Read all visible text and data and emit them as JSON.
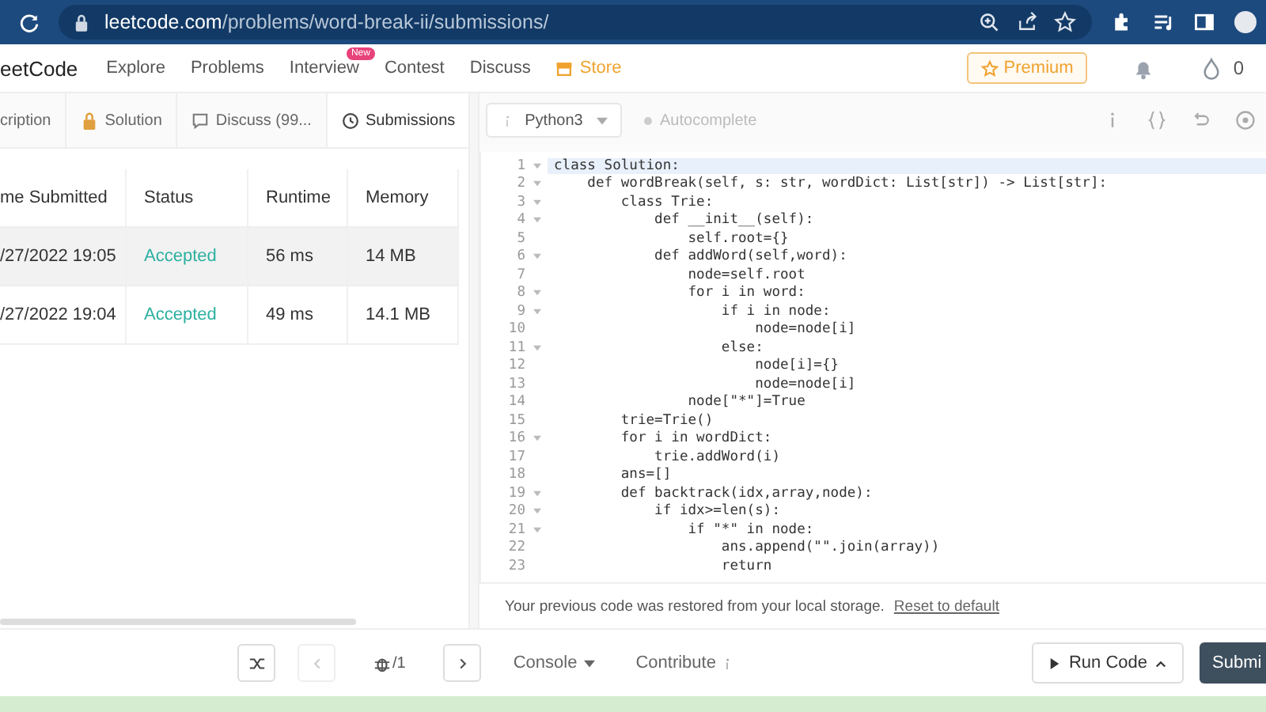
{
  "browser": {
    "url_host": "leetcode.com",
    "url_path": "/problems/word-break-ii/submissions/"
  },
  "nav": {
    "logo": "eetCode",
    "links": [
      {
        "label": "Explore",
        "kind": "plain"
      },
      {
        "label": "Problems",
        "kind": "plain"
      },
      {
        "label": "Interview",
        "badge": "New",
        "kind": "plain"
      },
      {
        "label": "Contest",
        "kind": "plain"
      },
      {
        "label": "Discuss",
        "kind": "plain"
      },
      {
        "label": "Store",
        "kind": "store"
      }
    ],
    "premium": "Premium",
    "coins": "0"
  },
  "tabs": [
    {
      "label": "cription",
      "selected": false
    },
    {
      "label": "Solution",
      "selected": false
    },
    {
      "label": "Discuss (99...",
      "selected": false
    },
    {
      "label": "Submissions",
      "selected": true
    }
  ],
  "table": {
    "columns": [
      "me Submitted",
      "Status",
      "Runtime",
      "Memory"
    ],
    "rows": [
      {
        "time": "/27/2022 19:05",
        "status": "Accepted",
        "runtime": "56 ms",
        "memory": "14 MB",
        "selected": true
      },
      {
        "time": "/27/2022 19:04",
        "status": "Accepted",
        "runtime": "49 ms",
        "memory": "14.1 MB",
        "selected": false
      }
    ]
  },
  "editor": {
    "language": "Python3",
    "autocomplete": "Autocomplete",
    "lines": [
      {
        "n": "1",
        "text": "class Solution:",
        "fold": true
      },
      {
        "n": "2",
        "text": "    def wordBreak(self, s: str, wordDict: List[str]) -> List[str]:",
        "fold": true
      },
      {
        "n": "3",
        "text": "        class Trie:",
        "fold": true
      },
      {
        "n": "4",
        "text": "            def __init__(self):",
        "fold": true
      },
      {
        "n": "5",
        "text": "                self.root={}",
        "fold": false
      },
      {
        "n": "6",
        "text": "            def addWord(self,word):",
        "fold": true
      },
      {
        "n": "7",
        "text": "                node=self.root",
        "fold": false
      },
      {
        "n": "8",
        "text": "                for i in word:",
        "fold": true
      },
      {
        "n": "9",
        "text": "                    if i in node:",
        "fold": true
      },
      {
        "n": "10",
        "text": "                        node=node[i]",
        "fold": false
      },
      {
        "n": "11",
        "text": "                    else:",
        "fold": true
      },
      {
        "n": "12",
        "text": "                        node[i]={}",
        "fold": false
      },
      {
        "n": "13",
        "text": "                        node=node[i]",
        "fold": false
      },
      {
        "n": "14",
        "text": "                node[\"*\"]=True",
        "fold": false
      },
      {
        "n": "15",
        "text": "        trie=Trie()",
        "fold": false
      },
      {
        "n": "16",
        "text": "        for i in wordDict:",
        "fold": true
      },
      {
        "n": "17",
        "text": "            trie.addWord(i)",
        "fold": false
      },
      {
        "n": "18",
        "text": "        ans=[]",
        "fold": false
      },
      {
        "n": "19",
        "text": "        def backtrack(idx,array,node):",
        "fold": true
      },
      {
        "n": "20",
        "text": "            if idx>=len(s):",
        "fold": true
      },
      {
        "n": "21",
        "text": "                if \"*\" in node:",
        "fold": true
      },
      {
        "n": "22",
        "text": "                    ans.append(\"\".join(array))",
        "fold": false
      },
      {
        "n": "23",
        "text": "                    return",
        "fold": false
      }
    ],
    "notice": "Your previous code was restored from your local storage.",
    "notice_link": "Reset to default"
  },
  "footer": {
    "page": "/1",
    "console": "Console",
    "contribute": "Contribute",
    "run": "Run Code",
    "submit": "Submi"
  }
}
